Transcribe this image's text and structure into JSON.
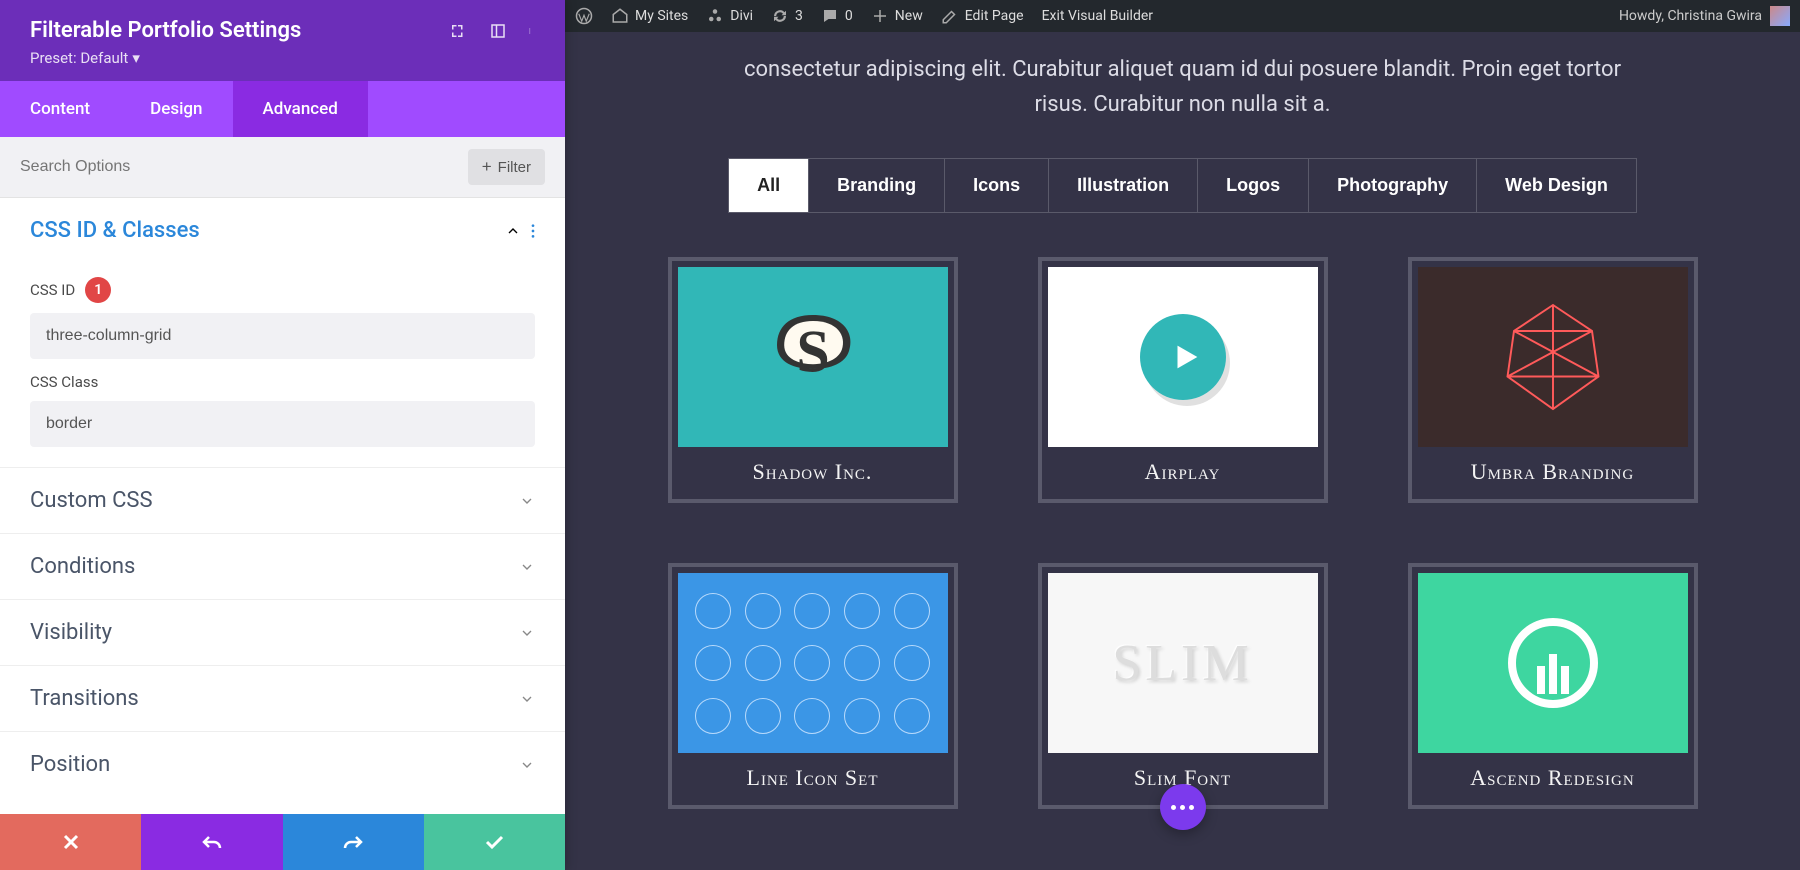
{
  "wp_bar": {
    "my_sites": "My Sites",
    "site_name": "Divi",
    "updates": "3",
    "comments": "0",
    "new": "New",
    "edit_page": "Edit Page",
    "exit_vb": "Exit Visual Builder",
    "greeting": "Howdy, Christina Gwira"
  },
  "panel": {
    "title": "Filterable Portfolio Settings",
    "preset": "Preset: Default",
    "tabs": {
      "content": "Content",
      "design": "Design",
      "advanced": "Advanced"
    },
    "search_placeholder": "Search Options",
    "filter_btn": "Filter",
    "groups": {
      "css_id_classes": {
        "title": "CSS ID & Classes",
        "css_id_label": "CSS ID",
        "css_id_value": "three-column-grid",
        "badge": "1",
        "css_class_label": "CSS Class",
        "css_class_value": "border"
      },
      "custom_css": "Custom CSS",
      "conditions": "Conditions",
      "visibility": "Visibility",
      "transitions": "Transitions",
      "position": "Position"
    }
  },
  "page": {
    "intro": "consectetur adipiscing elit. Curabitur aliquet quam id dui posuere blandit. Proin eget tortor risus. Curabitur non nulla sit a.",
    "filters": [
      "All",
      "Branding",
      "Icons",
      "Illustration",
      "Logos",
      "Photography",
      "Web Design"
    ],
    "items": [
      {
        "title": "Shadow Inc."
      },
      {
        "title": "Airplay"
      },
      {
        "title": "Umbra Branding"
      },
      {
        "title": "Line Icon Set"
      },
      {
        "title": "Slim Font"
      },
      {
        "title": "Ascend Redesign"
      }
    ]
  }
}
